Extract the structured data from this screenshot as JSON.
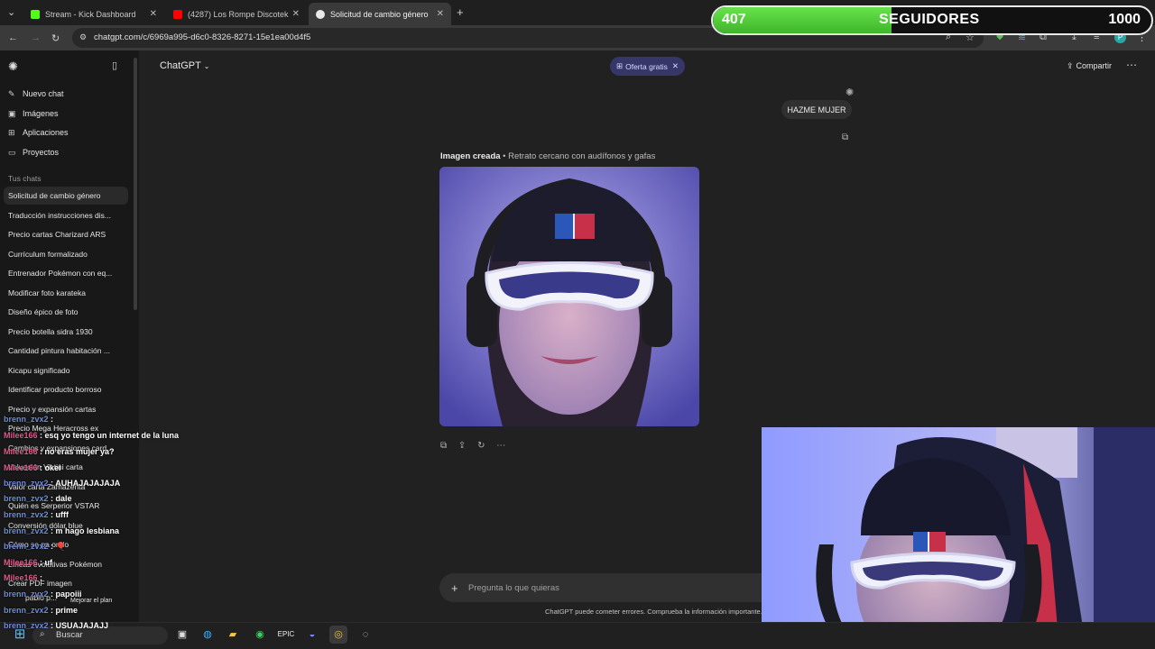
{
  "browser": {
    "tabs": [
      {
        "title": "Stream - Kick Dashboard",
        "fav_color": "#53fc18"
      },
      {
        "title": "(4287) Los Rompe Discotek",
        "fav_color": "#ff0000"
      },
      {
        "title": "Solicitud de cambio género",
        "fav_color": "#e8e8e8"
      }
    ],
    "url": "chatgpt.com/c/6969a995-d6c0-8326-8271-15e1ea00d4f5"
  },
  "followers": {
    "current": "407",
    "label": "SEGUIDORES",
    "goal": "1000",
    "progress": 0.407,
    "fill_color": "#52cf38"
  },
  "sidebar": {
    "nav": [
      {
        "label": "Nuevo chat",
        "icon": "edit-icon"
      },
      {
        "label": "Imágenes",
        "icon": "image-icon"
      },
      {
        "label": "Aplicaciones",
        "icon": "apps-icon"
      },
      {
        "label": "Proyectos",
        "icon": "folder-icon"
      }
    ],
    "section_title": "Tus chats",
    "chats": [
      "Solicitud de cambio género",
      "Traducción instrucciones dis...",
      "Precio cartas Charizard ARS",
      "Currículum formalizado",
      "Entrenador Pokémon con eq...",
      "Modificar foto karateka",
      "Diseño épico de foto",
      "Precio botella sidra 1930",
      "Cantidad pintura habitación ...",
      "Kicapu significado",
      "Identificar producto borroso",
      "Precio y expansión cartas",
      "Precio Mega Heracross ex",
      "Cambios y expansiones card...",
      "Valuación Victini carta",
      "Valor carta Zamazenta",
      "Quién es Serperior VSTAR",
      "Conversión dólar blue",
      "Cómo se pa   ondo",
      "Líneas evolutivas Pokémon",
      "Crear PDF imagen",
      "pablo p...",
      "Mejorar el plan"
    ]
  },
  "header": {
    "model": "ChatGPT",
    "offer": "Oferta gratis",
    "share": "Compartir"
  },
  "conversation": {
    "user_message": "HAZME MUJER",
    "caption_bold": "Imagen creada",
    "caption_rest": " • Retrato cercano con audífonos y gafas"
  },
  "composer": {
    "placeholder": "Pregunta lo que quieras",
    "disclaimer": "ChatGPT puede cometer errores. Comprueba la información importante."
  },
  "stream_chat": [
    {
      "user": "brenn_zvx2",
      "msg": ""
    },
    {
      "user": "Milee166",
      "msg": "esq yo tengo un internet de la luna"
    },
    {
      "user": "Milee166",
      "msg": "no eras mujer ya?"
    },
    {
      "user": "Milee166",
      "msg": "okei"
    },
    {
      "user": "brenn_zvx2",
      "msg": "AUHAJAJAJAJA"
    },
    {
      "user": "brenn_zvx2",
      "msg": "dale"
    },
    {
      "user": "brenn_zvx2",
      "msg": "ufff"
    },
    {
      "user": "brenn_zvx2",
      "msg": "m hago lesbiana"
    },
    {
      "user": "brenn_zvx2",
      "msg": "🎈"
    },
    {
      "user": "Milee166",
      "msg": "uf"
    },
    {
      "user": "Milee166",
      "msg": ""
    },
    {
      "user": "brenn_zvx2",
      "msg": "papoiii"
    },
    {
      "user": "brenn_zvx2",
      "msg": "prime"
    },
    {
      "user": "brenn_zvx2",
      "msg": "USUAJAJAJJ"
    }
  ],
  "taskbar": {
    "search": "Buscar"
  }
}
